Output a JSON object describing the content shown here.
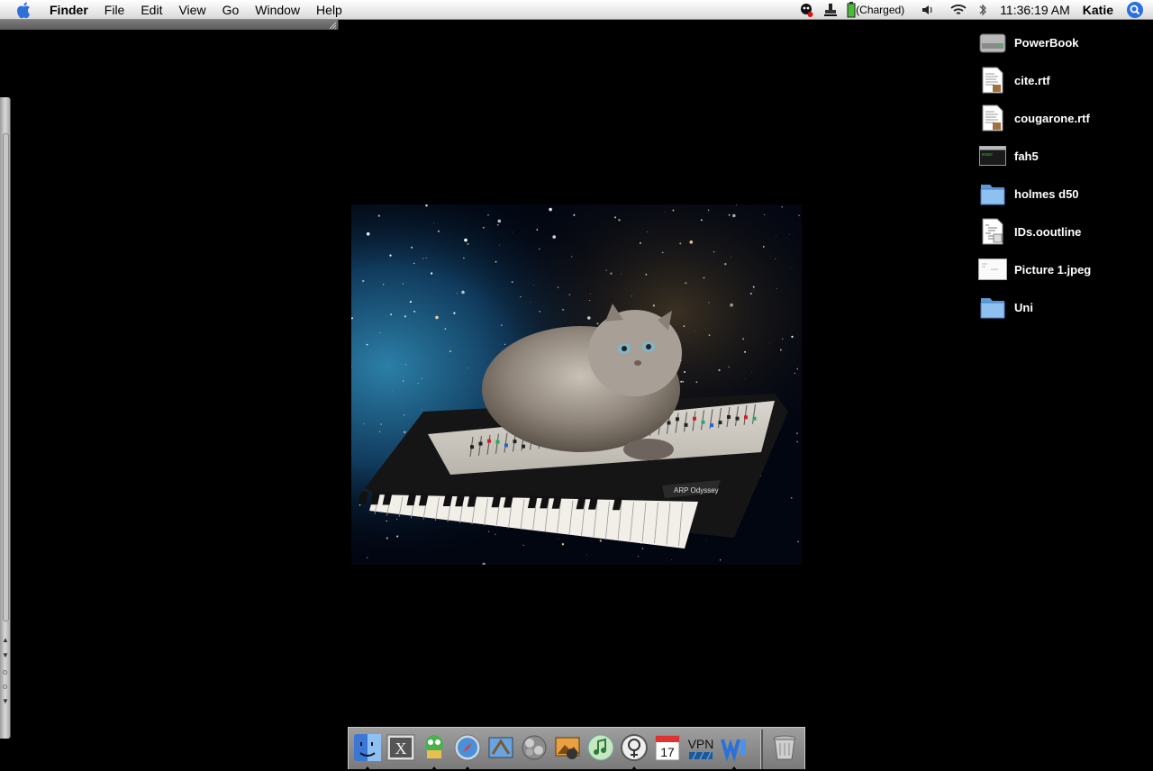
{
  "menubar": {
    "app_name": "Finder",
    "menus": [
      "File",
      "Edit",
      "View",
      "Go",
      "Window",
      "Help"
    ],
    "status": {
      "battery_text": "(Charged)",
      "clock": "11:36:19 AM",
      "user": "Katie"
    },
    "icons": [
      "apple-icon",
      "chat-status-icon",
      "stamp-icon",
      "battery-icon",
      "wifi-icon",
      "bluetooth-icon",
      "volume-icon",
      "spotlight-icon"
    ]
  },
  "desktop": {
    "picture": "cat sitting on an ARP Odyssey synthesizer floating in space",
    "synth_badge": "ARP Odyssey",
    "icons": [
      {
        "label": "PowerBook",
        "icon": "hard-drive-icon"
      },
      {
        "label": "cite.rtf",
        "icon": "rtf-document-icon"
      },
      {
        "label": "cougarone.rtf",
        "icon": "rtf-document-icon"
      },
      {
        "label": "fah5",
        "icon": "executable-icon"
      },
      {
        "label": "holmes d50",
        "icon": "folder-icon"
      },
      {
        "label": "IDs.ooutline",
        "icon": "outline-document-icon"
      },
      {
        "label": "Picture 1.jpeg",
        "icon": "jpeg-image-icon"
      },
      {
        "label": "Uni",
        "icon": "folder-icon"
      }
    ]
  },
  "dock": {
    "items": [
      {
        "name": "finder-dock-icon",
        "running": true
      },
      {
        "name": "terminal-x-dock-icon",
        "running": false
      },
      {
        "name": "adium-dock-icon",
        "running": true
      },
      {
        "name": "safari-dock-icon",
        "running": true
      },
      {
        "name": "mail-dock-icon",
        "running": false
      },
      {
        "name": "system-preferences-dock-icon",
        "running": false
      },
      {
        "name": "iphoto-dock-icon",
        "running": false
      },
      {
        "name": "itunes-dock-icon",
        "running": false
      },
      {
        "name": "font-book-dock-icon",
        "running": true
      },
      {
        "name": "ical-dock-icon",
        "running": false
      },
      {
        "name": "vpn-dock-icon",
        "running": false
      },
      {
        "name": "word-dock-icon",
        "running": true
      },
      {
        "name": "trash-dock-icon",
        "running": false
      }
    ],
    "ical_day": "17",
    "vpn_label": "VPN",
    "x_label": "X"
  },
  "colors": {
    "desktop": "#000000",
    "folder_blue": "#7fb2e6",
    "menubar": "#ececec",
    "dock": "#8a8a8a"
  }
}
